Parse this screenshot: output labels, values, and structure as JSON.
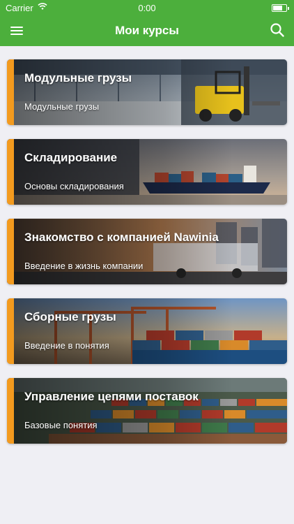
{
  "status_bar": {
    "carrier": "Carrier",
    "time": "0:00"
  },
  "nav": {
    "title": "Мои курсы",
    "menu_icon": "hamburger-menu-icon",
    "search_icon": "search-icon"
  },
  "colors": {
    "primary": "#4caf3c",
    "accent": "#f39a1e",
    "background": "#efeff4"
  },
  "courses": [
    {
      "title": "Модульные грузы",
      "subtitle": "Модульные грузы",
      "image": "warehouse-forklift"
    },
    {
      "title": "Складирование",
      "subtitle": "Основы складирования",
      "image": "cargo-ship"
    },
    {
      "title": "Знакомство с компанией Nawinia",
      "subtitle": "Введение в жизнь компании",
      "image": "truck-city"
    },
    {
      "title": "Сборные грузы",
      "subtitle": "Введение в понятия",
      "image": "container-port-cranes"
    },
    {
      "title": "Управление цепями поставок",
      "subtitle": "Базовые понятия",
      "image": "container-terminal"
    }
  ]
}
